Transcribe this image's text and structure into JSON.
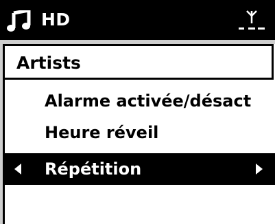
{
  "header": {
    "title": "HD",
    "icon": "music-note-icon",
    "status_icon": "antenna-signal-icon"
  },
  "breadcrumb": {
    "label": "Artists"
  },
  "menu": {
    "items": [
      {
        "label": "Alarme activée/désact"
      },
      {
        "label": "Heure réveil"
      },
      {
        "label": "Répétition"
      }
    ],
    "selected_index": 2
  },
  "colors": {
    "header_bg": "#000000",
    "screen_bg": "#ffffff",
    "selection_bg": "#000000"
  }
}
